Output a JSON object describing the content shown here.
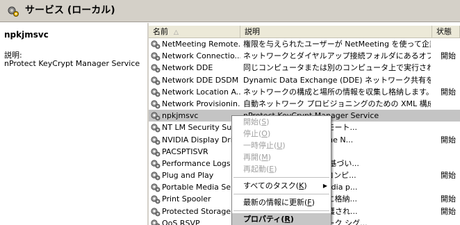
{
  "window": {
    "title": "サービス (ローカル)",
    "title_icon": "gears-icon"
  },
  "details": {
    "service_name": "npkjmsvc",
    "description_label": "説明:",
    "description": "nProtect KeyCrypt Manager Service"
  },
  "columns": {
    "name": "名前",
    "description": "説明",
    "status": "状態",
    "sort_indicator": "△"
  },
  "services": [
    {
      "name": "NetMeeting Remote...",
      "description": "権限を与えられたユーザーが NetMeeting を使って企業...",
      "status": ""
    },
    {
      "name": "Network Connectio...",
      "description": "ネットワークとダイヤルアップ接続フォルダにあるオブジェクト...",
      "status": "開始"
    },
    {
      "name": "Network DDE",
      "description": "同じコンピュータまたは別のコンピュータ上で実行されたプロ...",
      "status": ""
    },
    {
      "name": "Network DDE DSDM",
      "description": "Dynamic Data Exchange (DDE) ネットワーク共有を管...",
      "status": ""
    },
    {
      "name": "Network Location A...",
      "description": "ネットワークの構成と場所の情報を収集し格納します。こ...",
      "status": "開始"
    },
    {
      "name": "Network Provisionin...",
      "description": "自動ネットワーク プロビジョニングのための XML 構成ファイルをドメイ...",
      "status": ""
    },
    {
      "name": "npkjmsvc",
      "description": "nProtect KeyCrypt Manager Service",
      "status": ""
    },
    {
      "name": "NT LM Security Su",
      "description": "スポートを使っているリモート...",
      "status": ""
    },
    {
      "name": "NVIDIA Display Dri",
      "description": "ktop level support to the N...",
      "status": "開始"
    },
    {
      "name": "PACSPTISVR",
      "description": "",
      "status": ""
    },
    {
      "name": "Performance Logs a",
      "description": "ケジュール パラメータに基づい...",
      "status": ""
    },
    {
      "name": "Plug and Play",
      "description": "ア、または入力なしで、コンピ...",
      "status": "開始"
    },
    {
      "name": "Portable Media Ser",
      "description": "ber of any portable media p...",
      "status": ""
    },
    {
      "name": "Print Spooler",
      "description": "イルを読み込んでメモリに格納...",
      "status": "開始"
    },
    {
      "name": "Protected Storage",
      "description": "などを格納するための保護され...",
      "status": "開始"
    },
    {
      "name": "QoS RSVP",
      "description": "アプレットに、ネットワーク シグ...",
      "status": ""
    }
  ],
  "selected_index": 6,
  "context_menu": {
    "items": [
      {
        "label": "開始",
        "key": "S",
        "disabled": true
      },
      {
        "label": "停止",
        "key": "O",
        "disabled": true
      },
      {
        "label": "一時停止",
        "key": "U",
        "disabled": true
      },
      {
        "label": "再開",
        "key": "M",
        "disabled": true
      },
      {
        "label": "再起動",
        "key": "E",
        "disabled": true
      },
      {
        "separator": true
      },
      {
        "label": "すべてのタスク",
        "key": "K",
        "disabled": false,
        "submenu": true
      },
      {
        "separator": true
      },
      {
        "label": "最新の情報に更新",
        "key": "F",
        "disabled": false
      },
      {
        "separator": true
      },
      {
        "label": "プロパティ",
        "key": "R",
        "disabled": false,
        "bold": true,
        "highlight": true
      }
    ]
  }
}
